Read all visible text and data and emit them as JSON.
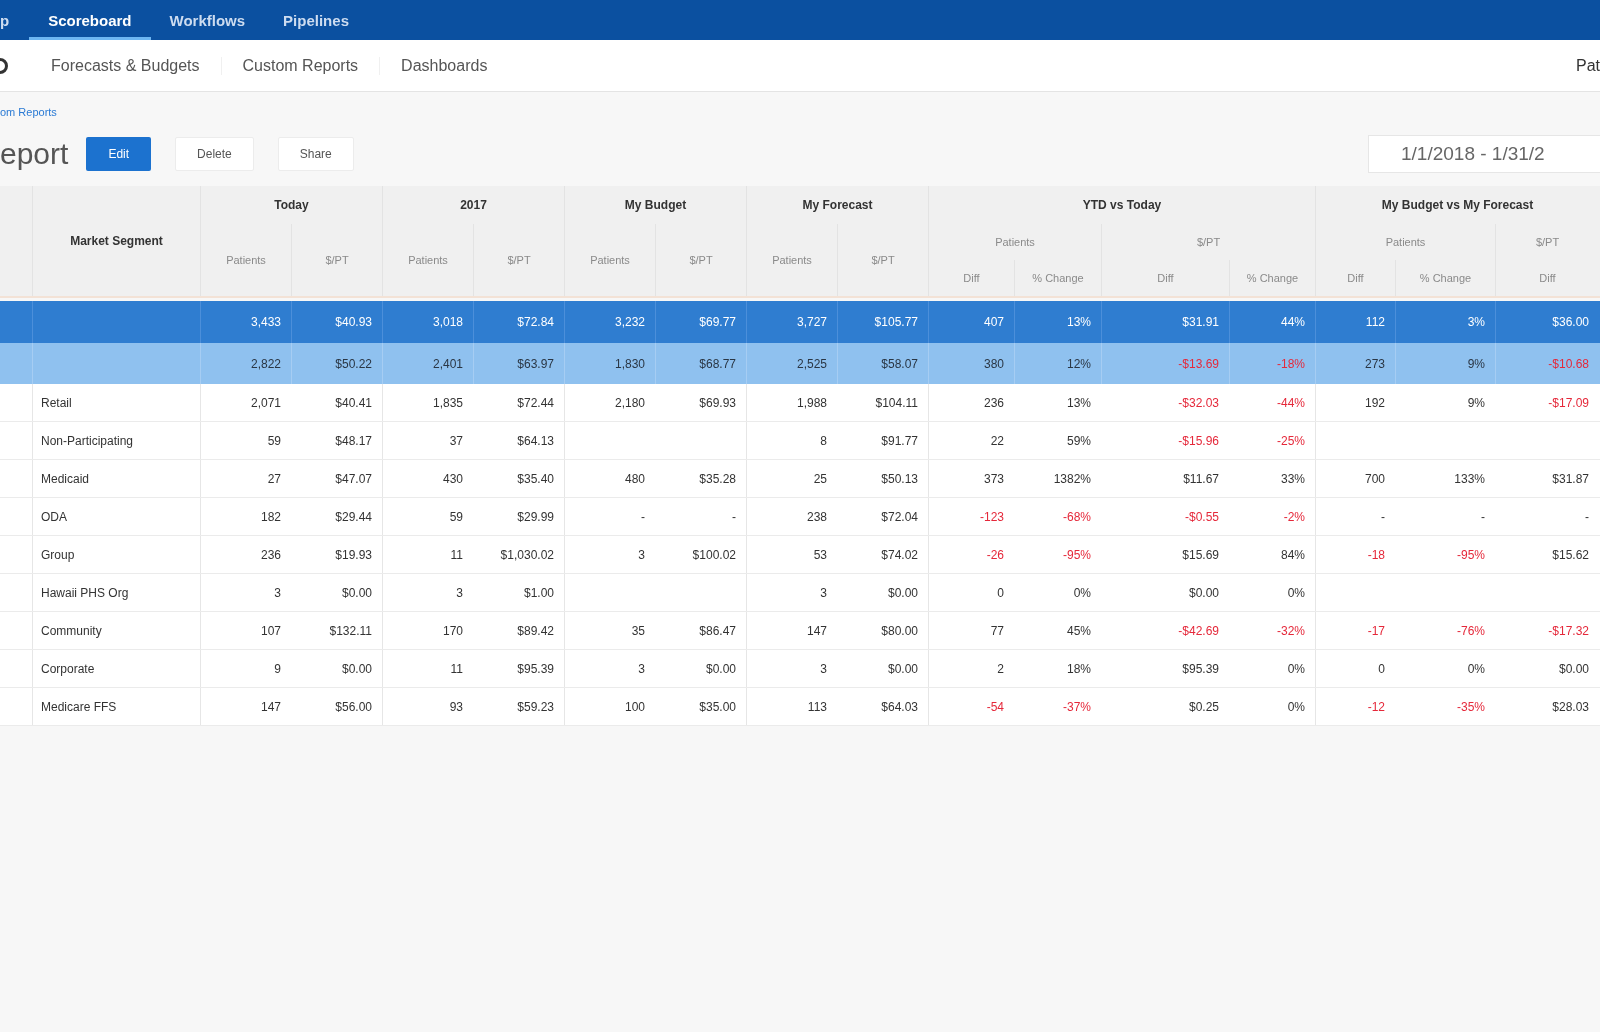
{
  "top_nav": {
    "items": [
      {
        "label": "p",
        "selected": false
      },
      {
        "label": "Scoreboard",
        "selected": true
      },
      {
        "label": "Workflows",
        "selected": false
      },
      {
        "label": "Pipelines",
        "selected": false
      }
    ]
  },
  "sub_nav": {
    "items": [
      "Forecasts & Budgets",
      "Custom Reports",
      "Dashboards"
    ],
    "user": "Pat"
  },
  "breadcrumb": "om Reports",
  "header": {
    "title": "eport",
    "buttons": [
      {
        "label": "Edit",
        "kind": "primary"
      },
      {
        "label": "Delete",
        "kind": "default"
      },
      {
        "label": "Share",
        "kind": "default"
      }
    ],
    "date_range": {
      "value": "1/1/2018 - 1/31/2"
    }
  },
  "table": {
    "segment_heading": "Market Segment",
    "groups": [
      {
        "title": "Today",
        "columns": [
          {
            "title": "Patients"
          },
          {
            "title": "$/PT"
          }
        ]
      },
      {
        "title": "2017",
        "columns": [
          {
            "title": "Patients"
          },
          {
            "title": "$/PT"
          }
        ]
      },
      {
        "title": "My Budget",
        "columns": [
          {
            "title": "Patients"
          },
          {
            "title": "$/PT"
          }
        ]
      },
      {
        "title": "My Forecast",
        "columns": [
          {
            "title": "Patients"
          },
          {
            "title": "$/PT"
          }
        ]
      },
      {
        "title": "YTD vs Today",
        "columns": [
          {
            "title": "Patients",
            "columns": [
              "Diff",
              "% Change"
            ]
          },
          {
            "title": "$/PT",
            "columns": [
              "Diff",
              "% Change"
            ]
          }
        ]
      },
      {
        "title": "My Budget vs My Forecast",
        "columns": [
          {
            "title": "Patients",
            "columns": [
              "Diff",
              "% Change"
            ]
          },
          {
            "title": "$/PT",
            "columns": [
              "Diff"
            ]
          }
        ]
      }
    ],
    "rows": [
      {
        "kind": "total",
        "cells": [
          {
            "value": "3,433"
          },
          {
            "value": "$40.93"
          },
          {
            "value": "3,018"
          },
          {
            "value": "$72.84"
          },
          {
            "value": "3,232"
          },
          {
            "value": "$69.77"
          },
          {
            "value": "3,727"
          },
          {
            "value": "$105.77"
          },
          {
            "value": "407"
          },
          {
            "value": "13%"
          },
          {
            "value": "$31.91"
          },
          {
            "value": "44%"
          },
          {
            "value": "112"
          },
          {
            "value": "3%"
          },
          {
            "value": "$36.00"
          }
        ]
      },
      {
        "kind": "subtotal",
        "cells": [
          {
            "value": "2,822",
            "negative": false
          },
          {
            "value": "$50.22",
            "negative": false
          },
          {
            "value": "2,401",
            "negative": false
          },
          {
            "value": "$63.97",
            "negative": false
          },
          {
            "value": "1,830",
            "negative": false
          },
          {
            "value": "$68.77",
            "negative": false
          },
          {
            "value": "2,525",
            "negative": false
          },
          {
            "value": "$58.07",
            "negative": false
          },
          {
            "value": "380",
            "negative": false
          },
          {
            "value": "12%",
            "negative": false
          },
          {
            "value": "-$13.69",
            "negative": true
          },
          {
            "value": "-18%",
            "negative": true
          },
          {
            "value": "273",
            "negative": false
          },
          {
            "value": "9%",
            "negative": false
          },
          {
            "value": "-$10.68",
            "negative": true
          }
        ]
      },
      {
        "kind": "data",
        "segment": "Retail",
        "cells": [
          {
            "value": "2,071",
            "negative": false
          },
          {
            "value": "$40.41",
            "negative": false
          },
          {
            "value": "1,835",
            "negative": false
          },
          {
            "value": "$72.44",
            "negative": false
          },
          {
            "value": "2,180",
            "negative": false
          },
          {
            "value": "$69.93",
            "negative": false
          },
          {
            "value": "1,988",
            "negative": false
          },
          {
            "value": "$104.11",
            "negative": false
          },
          {
            "value": "236",
            "negative": false
          },
          {
            "value": "13%",
            "negative": false
          },
          {
            "value": "-$32.03",
            "negative": true
          },
          {
            "value": "-44%",
            "negative": true
          },
          {
            "value": "192",
            "negative": false
          },
          {
            "value": "9%",
            "negative": false
          },
          {
            "value": "-$17.09",
            "negative": true
          }
        ]
      },
      {
        "kind": "data",
        "segment": "Non-Participating",
        "cells": [
          {
            "value": "59",
            "negative": false
          },
          {
            "value": "$48.17",
            "negative": false
          },
          {
            "value": "37",
            "negative": false
          },
          {
            "value": "$64.13",
            "negative": false
          },
          null,
          null,
          {
            "value": "8",
            "negative": false
          },
          {
            "value": "$91.77",
            "negative": false
          },
          {
            "value": "22",
            "negative": false
          },
          {
            "value": "59%",
            "negative": false
          },
          {
            "value": "-$15.96",
            "negative": true
          },
          {
            "value": "-25%",
            "negative": true
          },
          null,
          null,
          null
        ]
      },
      {
        "kind": "data",
        "segment": "Medicaid",
        "cells": [
          {
            "value": "27",
            "negative": false
          },
          {
            "value": "$47.07",
            "negative": false
          },
          {
            "value": "430",
            "negative": false
          },
          {
            "value": "$35.40",
            "negative": false
          },
          {
            "value": "480",
            "negative": false
          },
          {
            "value": "$35.28",
            "negative": false
          },
          {
            "value": "25",
            "negative": false
          },
          {
            "value": "$50.13",
            "negative": false
          },
          {
            "value": "373",
            "negative": false
          },
          {
            "value": "1382%",
            "negative": false
          },
          {
            "value": "$11.67",
            "negative": false
          },
          {
            "value": "33%",
            "negative": false
          },
          {
            "value": "700",
            "negative": false
          },
          {
            "value": "133%",
            "negative": false
          },
          {
            "value": "$31.87",
            "negative": false
          }
        ]
      },
      {
        "kind": "data",
        "segment": "ODA",
        "cells": [
          {
            "value": "182",
            "negative": false
          },
          {
            "value": "$29.44",
            "negative": false
          },
          {
            "value": "59",
            "negative": false
          },
          {
            "value": "$29.99",
            "negative": false
          },
          {
            "value": "-",
            "negative": false
          },
          {
            "value": "-",
            "negative": false
          },
          {
            "value": "238",
            "negative": false
          },
          {
            "value": "$72.04",
            "negative": false
          },
          {
            "value": "-123",
            "negative": true
          },
          {
            "value": "-68%",
            "negative": true
          },
          {
            "value": "-$0.55",
            "negative": true
          },
          {
            "value": "-2%",
            "negative": true
          },
          {
            "value": "-",
            "negative": false
          },
          {
            "value": "-",
            "negative": false
          },
          {
            "value": "-",
            "negative": false
          }
        ]
      },
      {
        "kind": "data",
        "segment": "Group",
        "cells": [
          {
            "value": "236",
            "negative": false
          },
          {
            "value": "$19.93",
            "negative": false
          },
          {
            "value": "11",
            "negative": false
          },
          {
            "value": "$1,030.02",
            "negative": false
          },
          {
            "value": "3",
            "negative": false
          },
          {
            "value": "$100.02",
            "negative": false
          },
          {
            "value": "53",
            "negative": false
          },
          {
            "value": "$74.02",
            "negative": false
          },
          {
            "value": "-26",
            "negative": true
          },
          {
            "value": "-95%",
            "negative": true
          },
          {
            "value": "$15.69",
            "negative": false
          },
          {
            "value": "84%",
            "negative": false
          },
          {
            "value": "-18",
            "negative": true
          },
          {
            "value": "-95%",
            "negative": true
          },
          {
            "value": "$15.62",
            "negative": false
          }
        ]
      },
      {
        "kind": "data",
        "segment": "Hawaii PHS Org",
        "cells": [
          {
            "value": "3",
            "negative": false
          },
          {
            "value": "$0.00",
            "negative": false
          },
          {
            "value": "3",
            "negative": false
          },
          {
            "value": "$1.00",
            "negative": false
          },
          null,
          null,
          {
            "value": "3",
            "negative": false
          },
          {
            "value": "$0.00",
            "negative": false
          },
          {
            "value": "0",
            "negative": false
          },
          {
            "value": "0%",
            "negative": false
          },
          {
            "value": "$0.00",
            "negative": false
          },
          {
            "value": "0%",
            "negative": false
          },
          null,
          null,
          null
        ]
      },
      {
        "kind": "data",
        "segment": "Community",
        "cells": [
          {
            "value": "107",
            "negative": false
          },
          {
            "value": "$132.11",
            "negative": false
          },
          {
            "value": "170",
            "negative": false
          },
          {
            "value": "$89.42",
            "negative": false
          },
          {
            "value": "35",
            "negative": false
          },
          {
            "value": "$86.47",
            "negative": false
          },
          {
            "value": "147",
            "negative": false
          },
          {
            "value": "$80.00",
            "negative": false
          },
          {
            "value": "77",
            "negative": false
          },
          {
            "value": "45%",
            "negative": false
          },
          {
            "value": "-$42.69",
            "negative": true
          },
          {
            "value": "-32%",
            "negative": true
          },
          {
            "value": "-17",
            "negative": true
          },
          {
            "value": "-76%",
            "negative": true
          },
          {
            "value": "-$17.32",
            "negative": true
          }
        ]
      },
      {
        "kind": "data",
        "segment": "Corporate",
        "cells": [
          {
            "value": "9",
            "negative": false
          },
          {
            "value": "$0.00",
            "negative": false
          },
          {
            "value": "11",
            "negative": false
          },
          {
            "value": "$95.39",
            "negative": false
          },
          {
            "value": "3",
            "negative": false
          },
          {
            "value": "$0.00",
            "negative": false
          },
          {
            "value": "3",
            "negative": false
          },
          {
            "value": "$0.00",
            "negative": false
          },
          {
            "value": "2",
            "negative": false
          },
          {
            "value": "18%",
            "negative": false
          },
          {
            "value": "$95.39",
            "negative": false
          },
          {
            "value": "0%",
            "negative": false
          },
          {
            "value": "0",
            "negative": false
          },
          {
            "value": "0%",
            "negative": false
          },
          {
            "value": "$0.00",
            "negative": false
          }
        ]
      },
      {
        "kind": "data",
        "segment": "Medicare FFS",
        "cells": [
          {
            "value": "147",
            "negative": false
          },
          {
            "value": "$56.00",
            "negative": false
          },
          {
            "value": "93",
            "negative": false
          },
          {
            "value": "$59.23",
            "negative": false
          },
          {
            "value": "100",
            "negative": false
          },
          {
            "value": "$35.00",
            "negative": false
          },
          {
            "value": "113",
            "negative": false
          },
          {
            "value": "$64.03",
            "negative": false
          },
          {
            "value": "-54",
            "negative": true
          },
          {
            "value": "-37%",
            "negative": true
          },
          {
            "value": "$0.25",
            "negative": false
          },
          {
            "value": "0%",
            "negative": false
          },
          {
            "value": "-12",
            "negative": true
          },
          {
            "value": "-35%",
            "negative": true
          },
          {
            "value": "$28.03",
            "negative": false
          }
        ]
      }
    ]
  }
}
